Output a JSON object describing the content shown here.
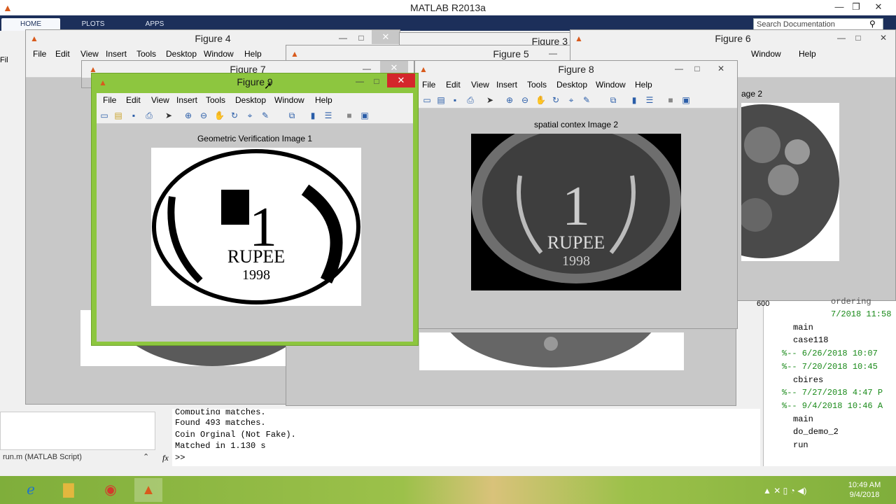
{
  "app": {
    "title": "MATLAB R2013a",
    "tabs": [
      "HOME",
      "PLOTS",
      "APPS"
    ],
    "search_placeholder": "Search Documentation",
    "menu_left": "File"
  },
  "menus": [
    "File",
    "Edit",
    "View",
    "Insert",
    "Tools",
    "Desktop",
    "Window",
    "Help"
  ],
  "figures": {
    "fig4": {
      "title": "Figure 4"
    },
    "fig5": {
      "title": "Figure 5"
    },
    "fig3": {
      "title": "Figure 3"
    },
    "fig6": {
      "title": "Figure 6",
      "caption": "age 2"
    },
    "fig7": {
      "title": "Figure 7"
    },
    "fig8": {
      "title": "Figure 8",
      "caption": "spatial contex Image 2"
    },
    "fig9": {
      "title": "Figure 9",
      "caption": "Geometric Verification Image 1"
    }
  },
  "coin_text": {
    "word": "RUPEE",
    "year": "1998",
    "numeral": "1"
  },
  "command_window": {
    "lines": [
      "Computing matches.",
      "Found 493 matches.",
      "Coin Orginal (Not Fake).",
      "Matched in 1.130 s"
    ],
    "prompt": ">>",
    "fx": "fx"
  },
  "editor_tab": "run.m (MATLAB Script)",
  "history": {
    "scroll_value": "600",
    "entries": [
      {
        "text": "ordering",
        "green": false
      },
      {
        "text": "7/2018 11:58",
        "green": true
      },
      {
        "text": "main",
        "green": false
      },
      {
        "text": "case118",
        "green": false
      },
      {
        "text": "%-- 6/26/2018 10:07",
        "green": true
      },
      {
        "text": "%-- 7/20/2018 10:45",
        "green": true
      },
      {
        "text": "cbires",
        "green": false
      },
      {
        "text": "%-- 7/27/2018 4:47 P",
        "green": true
      },
      {
        "text": "%-- 9/4/2018 10:46 A",
        "green": true
      },
      {
        "text": "main",
        "green": false
      },
      {
        "text": "do_demo_2",
        "green": false
      },
      {
        "text": "run",
        "green": false
      }
    ]
  },
  "taskbar": {
    "time": "10:49 AM",
    "date": "9/4/2018"
  },
  "colors": {
    "accent": "#8dc63f",
    "close": "#d4262b",
    "ribbon": "#1c2f5a"
  }
}
